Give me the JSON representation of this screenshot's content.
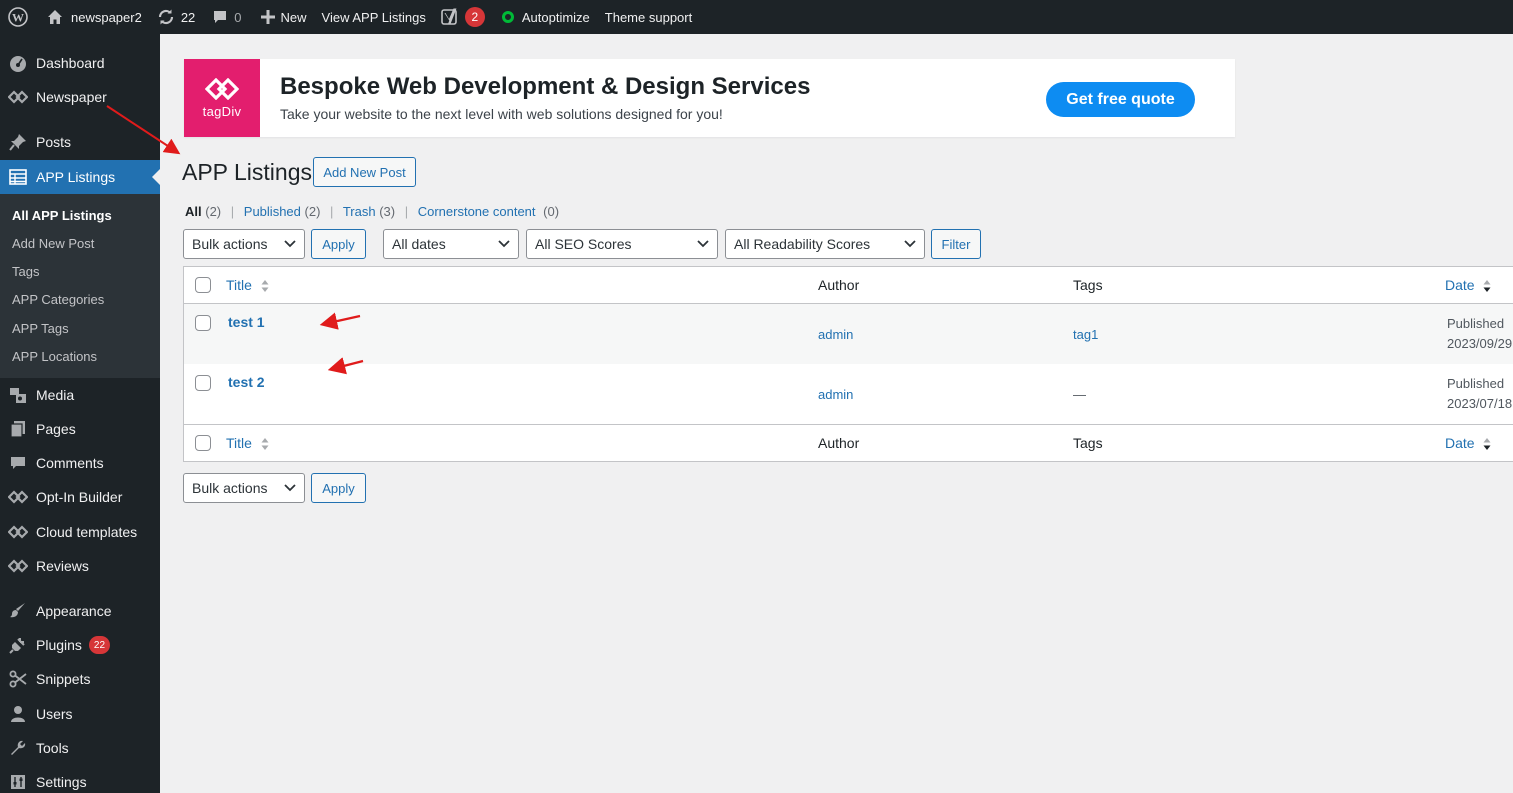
{
  "admin_bar": {
    "site_name": "newspaper2",
    "updates_count": "22",
    "comments_count": "0",
    "new_label": "New",
    "view_label": "View APP Listings",
    "yoast_count": "2",
    "autoptimize_label": "Autoptimize",
    "theme_support_label": "Theme support"
  },
  "sidebar": {
    "dashboard": "Dashboard",
    "newspaper": "Newspaper",
    "posts": "Posts",
    "app_listings": "APP Listings",
    "submenu": [
      "All APP Listings",
      "Add New Post",
      "Tags",
      "APP Categories",
      "APP Tags",
      "APP Locations"
    ],
    "media": "Media",
    "pages": "Pages",
    "comments": "Comments",
    "optin": "Opt-In Builder",
    "cloud": "Cloud templates",
    "reviews": "Reviews",
    "appearance": "Appearance",
    "plugins": "Plugins",
    "plugins_badge": "22",
    "snippets": "Snippets",
    "users": "Users",
    "tools": "Tools",
    "settings": "Settings"
  },
  "banner": {
    "logo_text": "tagDiv",
    "title": "Bespoke Web Development & Design Services",
    "subtitle": "Take your website to the next level with web solutions designed for you!",
    "button": "Get free quote",
    "accent": "#e31e6e",
    "button_color": "#0d8cf2"
  },
  "page": {
    "title": "APP Listings",
    "add_new": "Add New Post"
  },
  "views": {
    "all": "All",
    "all_count": "(2)",
    "published": "Published",
    "published_count": "(2)",
    "trash": "Trash",
    "trash_count": "(3)",
    "cornerstone": "Cornerstone content",
    "cornerstone_count": "(0)"
  },
  "filters": {
    "bulk_actions": "Bulk actions",
    "apply": "Apply",
    "dates": "All dates",
    "seo": "All SEO Scores",
    "readability": "All Readability Scores",
    "filter": "Filter"
  },
  "table": {
    "columns": {
      "title": "Title",
      "author": "Author",
      "tags": "Tags",
      "date": "Date"
    },
    "rows": [
      {
        "title": "test 1",
        "author": "admin",
        "tags": "tag1",
        "status": "Published",
        "date": "2023/09/29"
      },
      {
        "title": "test 2",
        "author": "admin",
        "tags": "—",
        "status": "Published",
        "date": "2023/07/18"
      }
    ]
  },
  "colors": {
    "primary": "#2271b1",
    "sidebar": "#1d2327",
    "badge": "#d63638",
    "annotation": "#e01b1b"
  }
}
